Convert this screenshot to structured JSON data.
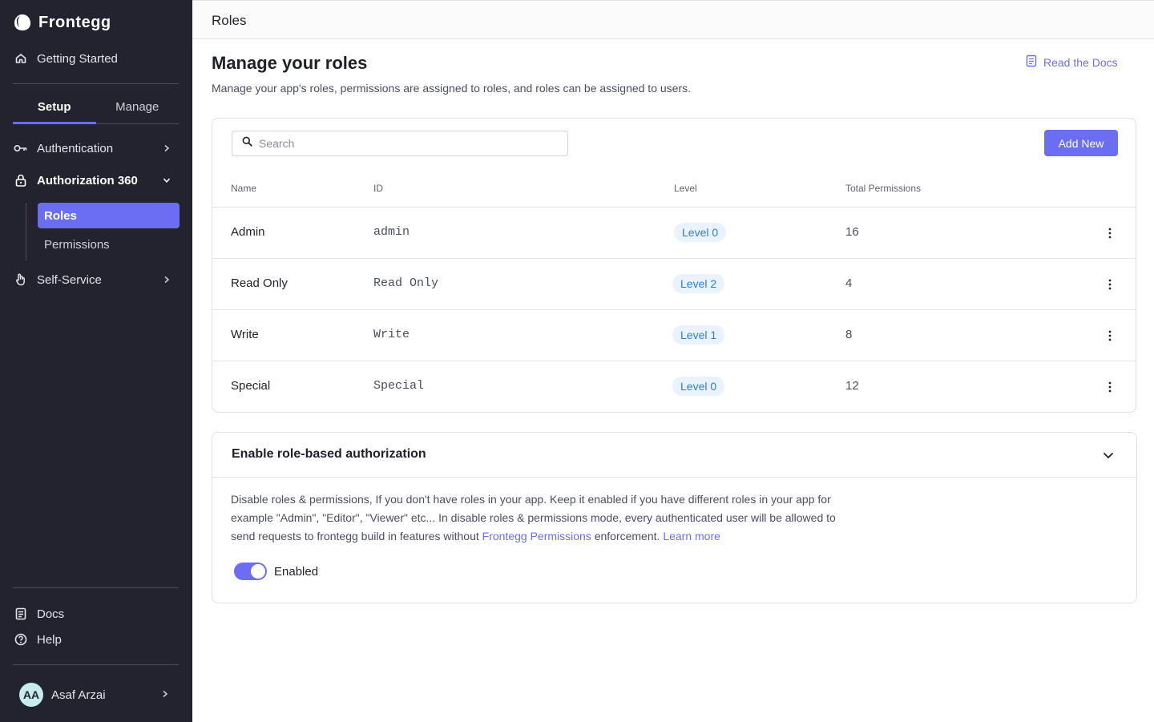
{
  "app": {
    "name": "Frontegg"
  },
  "sidebar": {
    "getting_started": "Getting Started",
    "tabs": [
      {
        "label": "Setup",
        "active": true
      },
      {
        "label": "Manage",
        "active": false
      }
    ],
    "items": [
      {
        "label": "Authentication",
        "icon": "key-icon"
      },
      {
        "label": "Authorization 360",
        "icon": "lock-icon",
        "expanded": true
      },
      {
        "label": "Self-Service",
        "icon": "hand-icon"
      }
    ],
    "subitems": [
      {
        "label": "Roles",
        "active": true
      },
      {
        "label": "Permissions",
        "active": false
      }
    ],
    "footer": [
      {
        "label": "Docs",
        "icon": "document-icon"
      },
      {
        "label": "Help",
        "icon": "help-circle-icon"
      }
    ],
    "user": {
      "initials": "AA",
      "name": "Asaf Arzai"
    }
  },
  "topbar": {
    "title": "Roles"
  },
  "main": {
    "title": "Manage your roles",
    "description": "Manage your app's roles, permissions are assigned to roles, and roles can be assigned to users.",
    "docs_link": "Read the Docs"
  },
  "roles": {
    "search_placeholder": "Search",
    "add_button": "Add New",
    "columns": [
      "Name",
      "ID",
      "Level",
      "Total Permissions"
    ],
    "rows": [
      {
        "name": "Admin",
        "id": "admin",
        "level": "Level 0",
        "permissions": "16"
      },
      {
        "name": "Read Only",
        "id": "Read Only",
        "level": "Level 2",
        "permissions": "4"
      },
      {
        "name": "Write",
        "id": "Write",
        "level": "Level 1",
        "permissions": "8"
      },
      {
        "name": "Special",
        "id": "Special",
        "level": "Level 0",
        "permissions": "12"
      }
    ]
  },
  "rbac": {
    "title": "Enable role-based authorization",
    "text_1": "Disable roles & permissions, If you don't have roles in your app. Keep it enabled if you have different roles in your app for example \"Admin\", \"Editor\", \"Viewer\" etc... In disable roles & permissions mode, every authenticated user will be allowed to send requests to frontegg build in features without ",
    "link_permissions": "Frontegg Permissions",
    "text_2": " enforcement. ",
    "link_learn": "Learn more",
    "toggle_label": "Enabled",
    "enabled": true
  },
  "colors": {
    "sidebar_bg": "#22232f",
    "accent": "#6b6ef2",
    "badge_bg": "#eaf3fd",
    "badge_text": "#2d7fd8"
  }
}
